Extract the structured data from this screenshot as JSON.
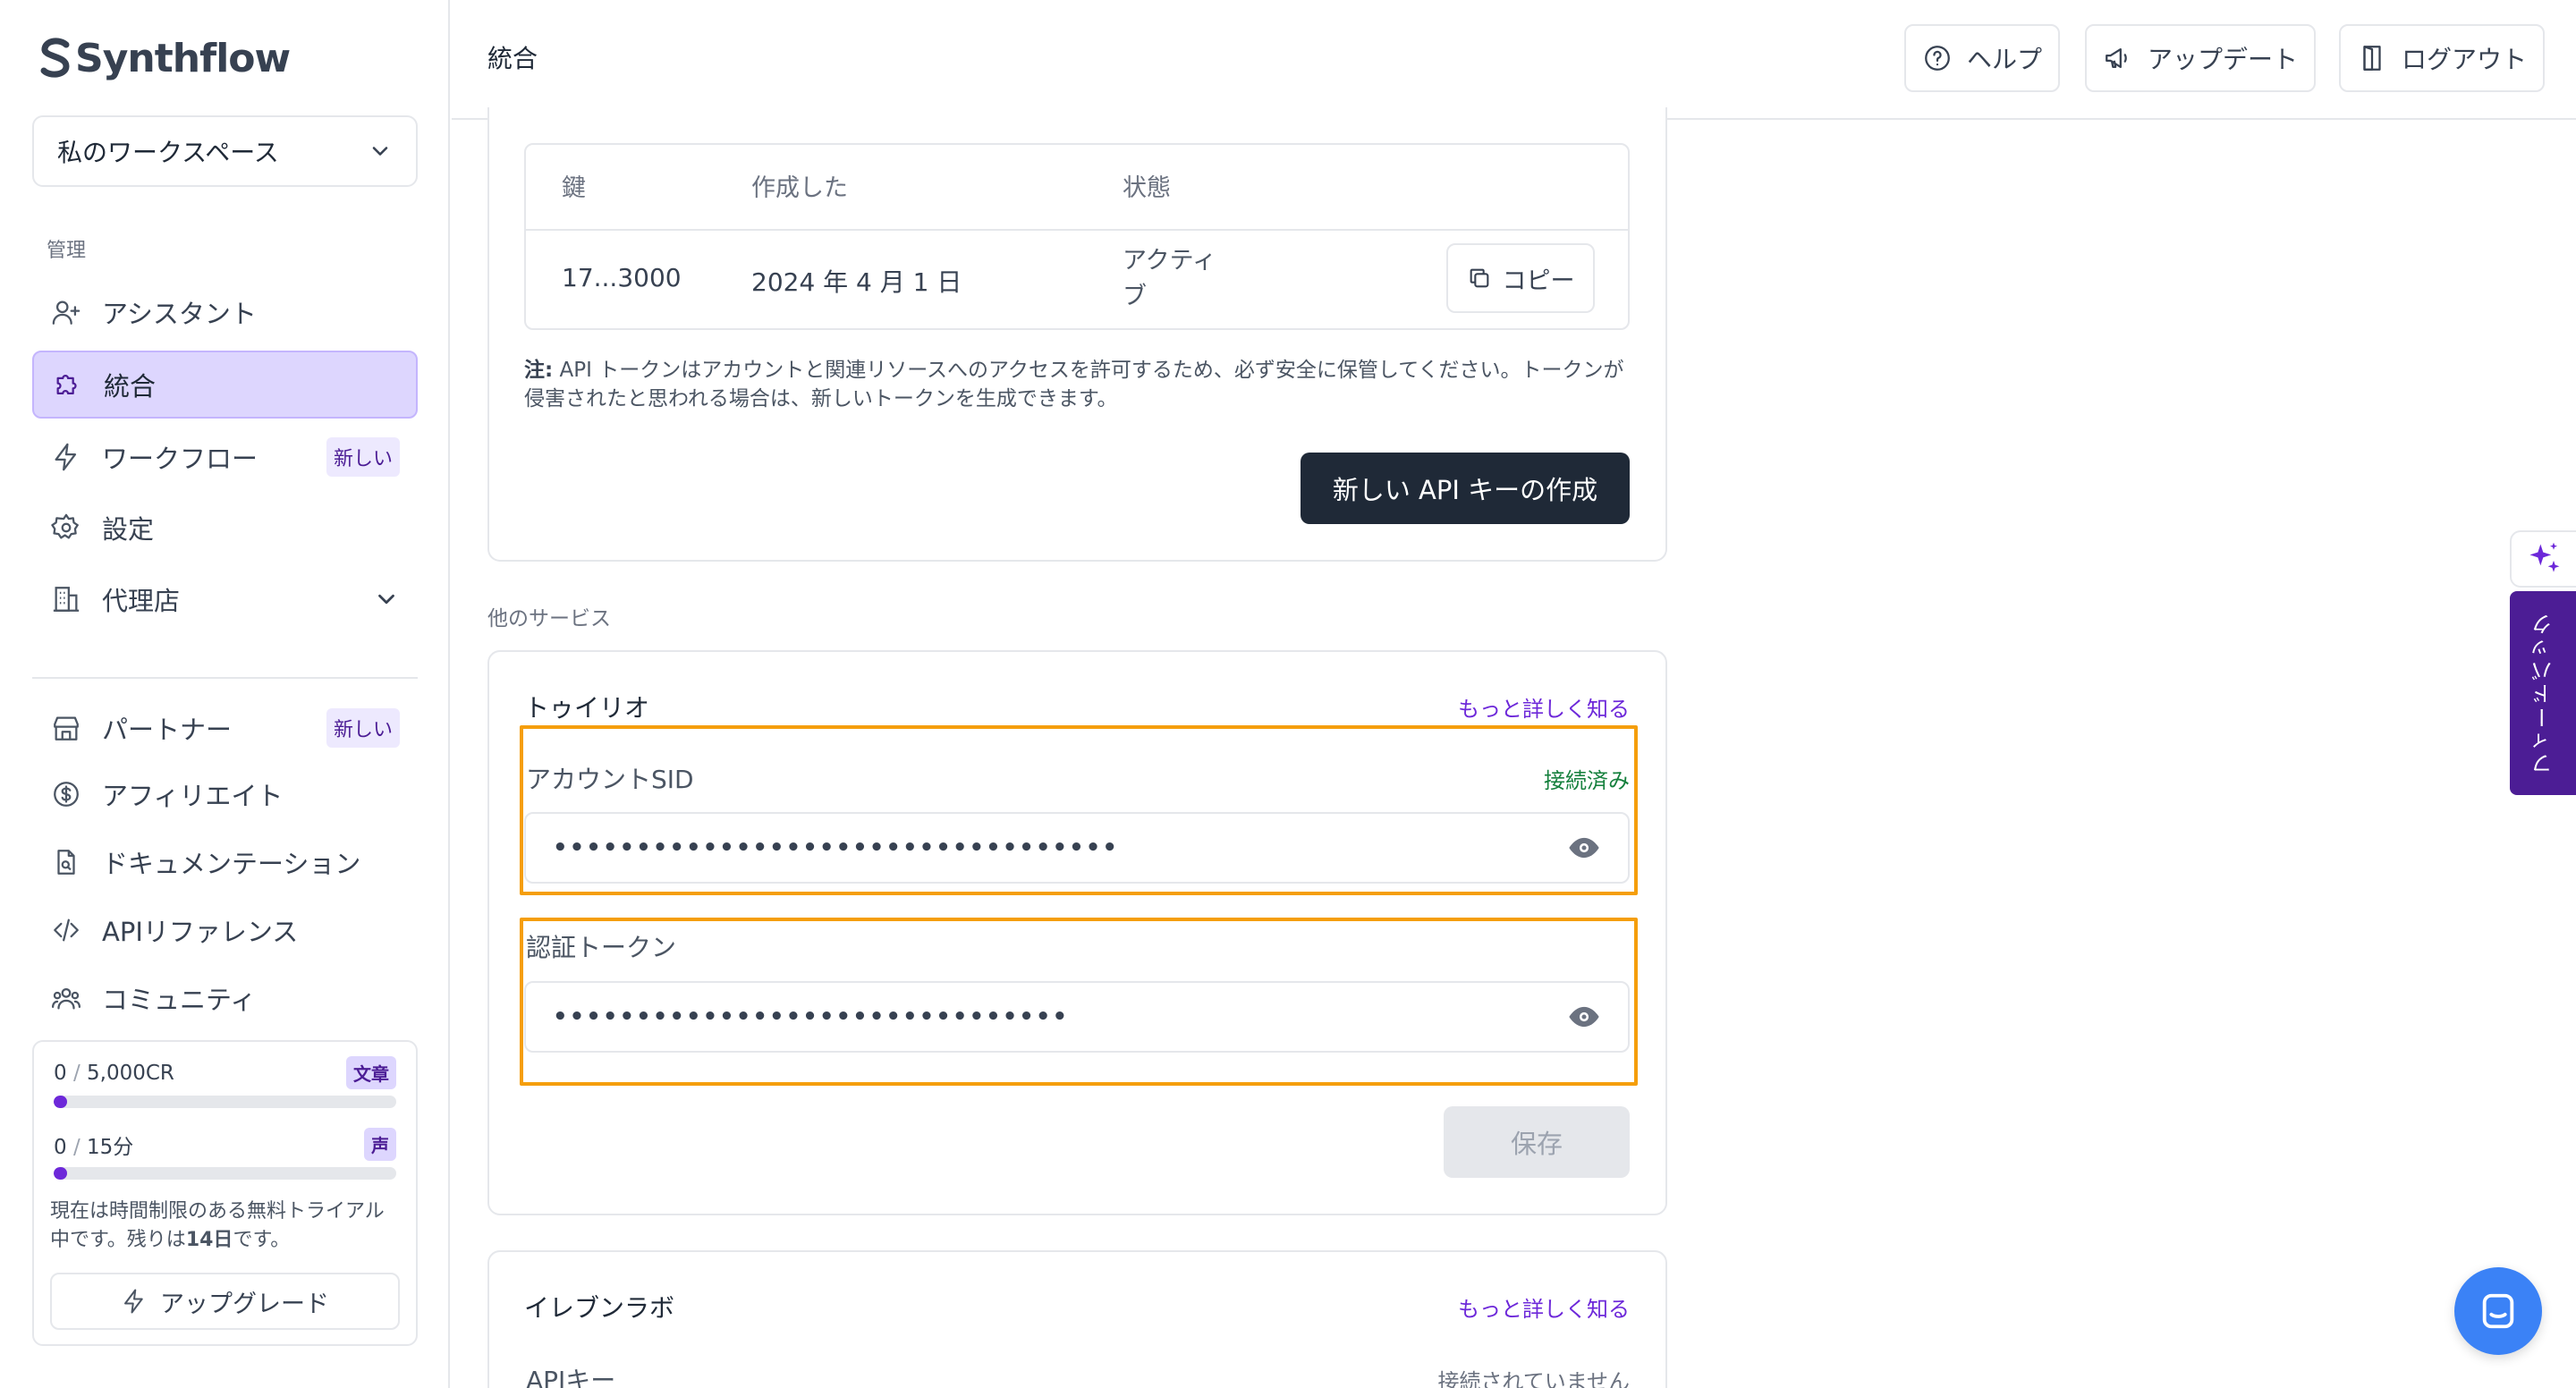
{
  "brand": {
    "name": "Synthflow"
  },
  "sidebar": {
    "workspace": "私のワークスペース",
    "section_manage": "管理",
    "items": [
      {
        "label": "アシスタント",
        "icon": "user-plus-icon"
      },
      {
        "label": "統合",
        "icon": "puzzle-icon",
        "active": true
      },
      {
        "label": "ワークフロー",
        "icon": "lightning-icon",
        "badge": "新しい"
      },
      {
        "label": "設定",
        "icon": "gear-icon"
      },
      {
        "label": "代理店",
        "icon": "building-icon"
      }
    ],
    "items2": [
      {
        "label": "パートナー",
        "icon": "store-icon",
        "badge": "新しい"
      },
      {
        "label": "アフィリエイト",
        "icon": "dollar-icon"
      },
      {
        "label": "ドキュメンテーション",
        "icon": "document-icon"
      },
      {
        "label": "APIリファレンス",
        "icon": "code-icon"
      },
      {
        "label": "コミュニティ",
        "icon": "users-icon"
      }
    ],
    "usage": {
      "credits_used": "0",
      "credits_total": "5,000CR",
      "credits_tag": "文章",
      "credits_fraction": 0.0,
      "minutes_used": "0",
      "minutes_total": "15分",
      "minutes_tag": "声",
      "minutes_fraction": 0.0,
      "trial_text_1": "現在は時間制限のある無料トライアル中です。残りは",
      "trial_days": "14日",
      "trial_text_2": "です。",
      "upgrade_label": "アップグレード"
    }
  },
  "header": {
    "title": "統合",
    "help": "ヘルプ",
    "updates": "アップデート",
    "logout": "ログアウト"
  },
  "api_keys": {
    "columns": [
      "鍵",
      "作成した",
      "状態"
    ],
    "row": {
      "key": "17...3000",
      "created": "2024 年 4 月 1 日",
      "status_line1": "アクティ",
      "status_line2": "ブ"
    },
    "copy_label": "コピー",
    "note_prefix": "注:",
    "note_text": " API トークンはアカウントと関連リソースへのアクセスを許可するため、必ず安全に保管してください。トークンが侵害されたと思われる場合は、新しいトークンを生成できます。",
    "create_label": "新しい API キーの作成"
  },
  "other_services_label": "他のサービス",
  "twilio": {
    "title": "トゥイリオ",
    "learn_more": "もっと詳しく知る",
    "sid_label": "アカウントSID",
    "sid_status": "接続済み",
    "sid_value": "••••••••••••••••••••••••••••••••••",
    "token_label": "認証トークン",
    "token_value": "•••••••••••••••••••••••••••••••",
    "save_label": "保存"
  },
  "elevenlabs": {
    "title": "イレブンラボ",
    "learn_more": "もっと詳しく知る",
    "api_key_label": "APIキー",
    "status": "接続されていません"
  },
  "feedback_tab": "フィードバック",
  "colors": {
    "accent": "#6d28d9",
    "active_bg": "#ddd6fe",
    "connected": "#15803d",
    "highlight": "#f59e0b",
    "dark_button": "#1f2937"
  }
}
